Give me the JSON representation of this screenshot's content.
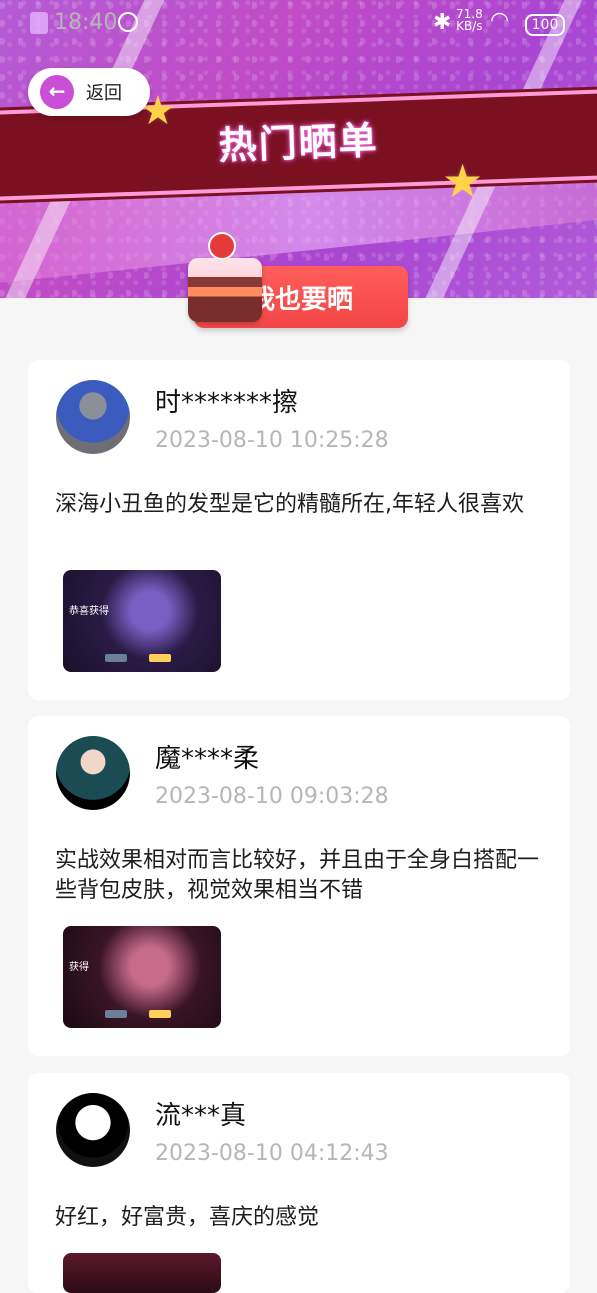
{
  "status_bar": {
    "time": "18:40",
    "network_speed": "71.8",
    "network_unit": "KB/s",
    "battery": "100"
  },
  "header": {
    "back_label": "返回",
    "banner_title": "热门晒单",
    "post_button": "我也要晒"
  },
  "posts": [
    {
      "username": "时*******擦",
      "timestamp": "2023-08-10 10:25:28",
      "content": "深海小丑鱼的发型是它的精髓所在,年轻人很喜欢"
    },
    {
      "username": "魔****柔",
      "timestamp": "2023-08-10 09:03:28",
      "content": "实战效果相对而言比较好，并且由于全身白搭配一些背包皮肤，视觉效果相当不错"
    },
    {
      "username": "流***真",
      "timestamp": "2023-08-10 04:12:43",
      "content": "好红，好富贵，喜庆的感觉"
    }
  ],
  "thumb_texts": {
    "thumb1_title": "恭喜获得",
    "thumb2_title": "获得"
  }
}
